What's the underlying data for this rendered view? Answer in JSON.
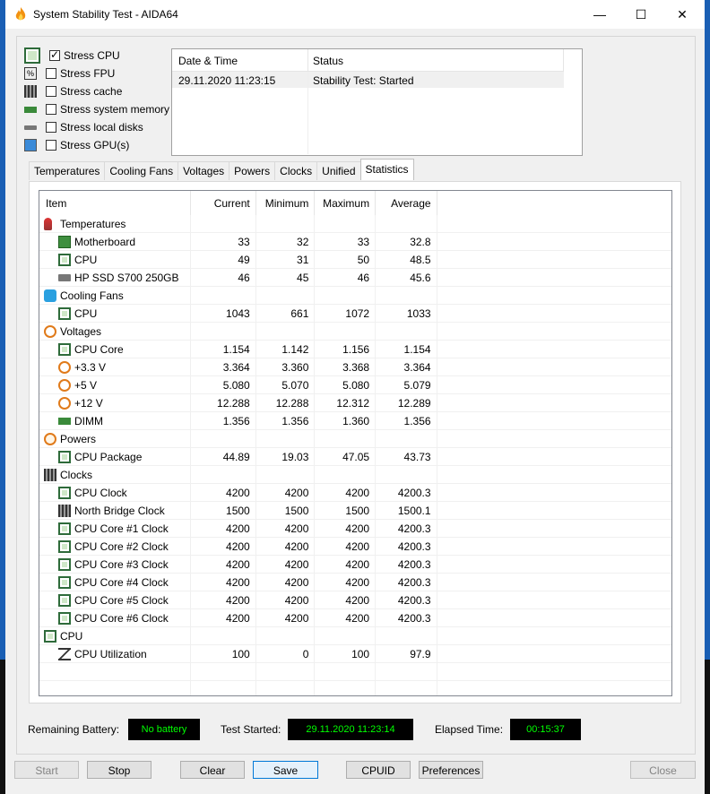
{
  "window": {
    "title": "System Stability Test - AIDA64",
    "minimize": "—",
    "maximize": "☐",
    "close": "✕"
  },
  "stress_options": [
    {
      "label": "Stress CPU",
      "checked": true,
      "icon": "cpu-chip-icon"
    },
    {
      "label": "Stress FPU",
      "checked": false,
      "icon": "fpu-icon"
    },
    {
      "label": "Stress cache",
      "checked": false,
      "icon": "cache-icon"
    },
    {
      "label": "Stress system memory",
      "checked": false,
      "icon": "memory-icon"
    },
    {
      "label": "Stress local disks",
      "checked": false,
      "icon": "disk-icon"
    },
    {
      "label": "Stress GPU(s)",
      "checked": false,
      "icon": "gpu-monitor-icon"
    }
  ],
  "log": {
    "col_datetime": "Date & Time",
    "col_status": "Status",
    "rows": [
      {
        "datetime": "29.11.2020 11:23:15",
        "status": "Stability Test: Started"
      }
    ]
  },
  "tabs": [
    "Temperatures",
    "Cooling Fans",
    "Voltages",
    "Powers",
    "Clocks",
    "Unified",
    "Statistics"
  ],
  "active_tab": "Statistics",
  "stats": {
    "columns": {
      "item": "Item",
      "current": "Current",
      "minimum": "Minimum",
      "maximum": "Maximum",
      "average": "Average"
    },
    "rows": [
      {
        "type": "group",
        "label": "Temperatures",
        "icon": "thermometer-icon"
      },
      {
        "type": "item",
        "label": "Motherboard",
        "icon": "motherboard-icon",
        "current": "33",
        "minimum": "32",
        "maximum": "33",
        "average": "32.8"
      },
      {
        "type": "item",
        "label": "CPU",
        "icon": "cpu-chip-icon",
        "current": "49",
        "minimum": "31",
        "maximum": "50",
        "average": "48.5"
      },
      {
        "type": "item",
        "label": "HP SSD S700 250GB",
        "icon": "disk-icon",
        "current": "46",
        "minimum": "45",
        "maximum": "46",
        "average": "45.6"
      },
      {
        "type": "group",
        "label": "Cooling Fans",
        "icon": "fan-icon"
      },
      {
        "type": "item",
        "label": "CPU",
        "icon": "cpu-chip-icon",
        "current": "1043",
        "minimum": "661",
        "maximum": "1072",
        "average": "1033"
      },
      {
        "type": "group",
        "label": "Voltages",
        "icon": "voltage-icon"
      },
      {
        "type": "item",
        "label": "CPU Core",
        "icon": "cpu-chip-icon",
        "current": "1.154",
        "minimum": "1.142",
        "maximum": "1.156",
        "average": "1.154"
      },
      {
        "type": "item",
        "label": "+3.3 V",
        "icon": "voltage-icon",
        "current": "3.364",
        "minimum": "3.360",
        "maximum": "3.368",
        "average": "3.364"
      },
      {
        "type": "item",
        "label": "+5 V",
        "icon": "voltage-icon",
        "current": "5.080",
        "minimum": "5.070",
        "maximum": "5.080",
        "average": "5.079"
      },
      {
        "type": "item",
        "label": "+12 V",
        "icon": "voltage-icon",
        "current": "12.288",
        "minimum": "12.288",
        "maximum": "12.312",
        "average": "12.289"
      },
      {
        "type": "item",
        "label": "DIMM",
        "icon": "memory-icon",
        "current": "1.356",
        "minimum": "1.356",
        "maximum": "1.360",
        "average": "1.356"
      },
      {
        "type": "group",
        "label": "Powers",
        "icon": "power-icon"
      },
      {
        "type": "item",
        "label": "CPU Package",
        "icon": "cpu-chip-icon",
        "current": "44.89",
        "minimum": "19.03",
        "maximum": "47.05",
        "average": "43.73"
      },
      {
        "type": "group",
        "label": "Clocks",
        "icon": "clock-chip-icon"
      },
      {
        "type": "item",
        "label": "CPU Clock",
        "icon": "cpu-chip-icon",
        "current": "4200",
        "minimum": "4200",
        "maximum": "4200",
        "average": "4200.3"
      },
      {
        "type": "item",
        "label": "North Bridge Clock",
        "icon": "clock-chip-icon",
        "current": "1500",
        "minimum": "1500",
        "maximum": "1500",
        "average": "1500.1"
      },
      {
        "type": "item",
        "label": "CPU Core #1 Clock",
        "icon": "cpu-chip-icon",
        "current": "4200",
        "minimum": "4200",
        "maximum": "4200",
        "average": "4200.3"
      },
      {
        "type": "item",
        "label": "CPU Core #2 Clock",
        "icon": "cpu-chip-icon",
        "current": "4200",
        "minimum": "4200",
        "maximum": "4200",
        "average": "4200.3"
      },
      {
        "type": "item",
        "label": "CPU Core #3 Clock",
        "icon": "cpu-chip-icon",
        "current": "4200",
        "minimum": "4200",
        "maximum": "4200",
        "average": "4200.3"
      },
      {
        "type": "item",
        "label": "CPU Core #4 Clock",
        "icon": "cpu-chip-icon",
        "current": "4200",
        "minimum": "4200",
        "maximum": "4200",
        "average": "4200.3"
      },
      {
        "type": "item",
        "label": "CPU Core #5 Clock",
        "icon": "cpu-chip-icon",
        "current": "4200",
        "minimum": "4200",
        "maximum": "4200",
        "average": "4200.3"
      },
      {
        "type": "item",
        "label": "CPU Core #6 Clock",
        "icon": "cpu-chip-icon",
        "current": "4200",
        "minimum": "4200",
        "maximum": "4200",
        "average": "4200.3"
      },
      {
        "type": "group",
        "label": "CPU",
        "icon": "cpu-chip-icon"
      },
      {
        "type": "item",
        "label": "CPU Utilization",
        "icon": "hourglass-icon",
        "current": "100",
        "minimum": "0",
        "maximum": "100",
        "average": "97.9"
      }
    ]
  },
  "status_bar": {
    "battery_label": "Remaining Battery:",
    "battery_value": "No battery",
    "started_label": "Test Started:",
    "started_value": "29.11.2020 11:23:14",
    "elapsed_label": "Elapsed Time:",
    "elapsed_value": "00:15:37",
    "lcd_color": "#00ff00"
  },
  "buttons": {
    "start": "Start",
    "stop": "Stop",
    "clear": "Clear",
    "save": "Save",
    "cpuid": "CPUID",
    "preferences": "Preferences",
    "close": "Close"
  }
}
